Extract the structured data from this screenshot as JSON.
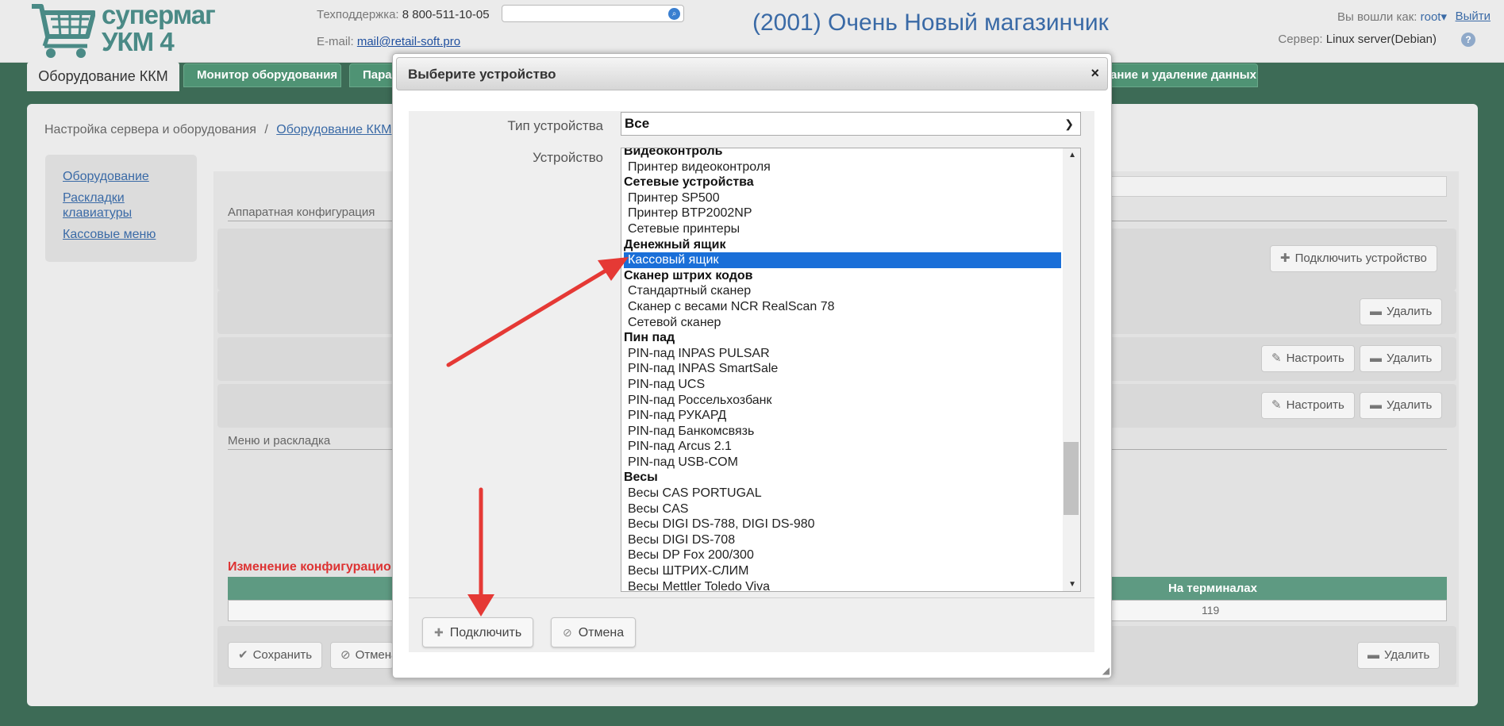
{
  "header": {
    "logo_line1": "супермаг",
    "logo_line2": "УКМ 4",
    "support_label": "Техподдержка:",
    "support_phone": "8 800-511-10-05",
    "email_label": "E-mail:",
    "email": "mail@retail-soft.pro",
    "shop_title": "(2001) Очень Новый магазинчик",
    "login_label": "Вы вошли как:",
    "login_user": "root",
    "logout": "Выйти",
    "server_label": "Сервер:",
    "server_value": "Linux server(Debian)",
    "help": "?"
  },
  "tabs": {
    "active": "Оборудование ККМ",
    "items": [
      "Монитор оборудования",
      "Парам",
      "ание и удаление данных"
    ]
  },
  "breadcrumb": {
    "root": "Настройка сервера и оборудования",
    "separator": "/",
    "current": "Оборудование ККМ"
  },
  "sidebar": {
    "items": [
      "Оборудование",
      "Раскладки клавиатуры",
      "Кассовые меню"
    ]
  },
  "content": {
    "hardware_section": "Аппаратная конфигурация",
    "menu_section": "Меню и раскладка",
    "connect_device": "Подключить устройство",
    "delete": "Удалить",
    "configure": "Настроить",
    "warning": "Изменение конфигурацио",
    "terminals_header": "На терминалах",
    "terminals_value": "119",
    "save": "Сохранить",
    "cancel": "Отмена"
  },
  "dialog": {
    "title": "Выберите устройство",
    "close": "×",
    "type_label": "Тип устройства",
    "type_value": "Все",
    "device_label": "Устройство",
    "devices": [
      {
        "text": "Видеоконтроль",
        "kind": "group"
      },
      {
        "text": "Принтер видеоконтроля",
        "kind": "item"
      },
      {
        "text": "Сетевые устройства",
        "kind": "group"
      },
      {
        "text": "Принтер SP500",
        "kind": "item"
      },
      {
        "text": "Принтер BTP2002NP",
        "kind": "item"
      },
      {
        "text": "Сетевые принтеры",
        "kind": "item"
      },
      {
        "text": "Денежный ящик",
        "kind": "group"
      },
      {
        "text": "Кассовый ящик",
        "kind": "selected"
      },
      {
        "text": "Сканер штрих кодов",
        "kind": "group"
      },
      {
        "text": "Стандартный сканер",
        "kind": "item"
      },
      {
        "text": "Сканер с весами NCR RealScan 78",
        "kind": "item"
      },
      {
        "text": "Сетевой сканер",
        "kind": "item"
      },
      {
        "text": "Пин пад",
        "kind": "group"
      },
      {
        "text": "PIN-пад INPAS PULSAR",
        "kind": "item"
      },
      {
        "text": "PIN-пад INPAS SmartSale",
        "kind": "item"
      },
      {
        "text": "PIN-пад UCS",
        "kind": "item"
      },
      {
        "text": "PIN-пад Россельхозбанк",
        "kind": "item"
      },
      {
        "text": "PIN-пад РУКАРД",
        "kind": "item"
      },
      {
        "text": "PIN-пад Банкомсвязь",
        "kind": "item"
      },
      {
        "text": "PIN-пад Arcus 2.1",
        "kind": "item"
      },
      {
        "text": "PIN-пад USB-COM",
        "kind": "item"
      },
      {
        "text": "Весы",
        "kind": "group"
      },
      {
        "text": "Весы CAS PORTUGAL",
        "kind": "item"
      },
      {
        "text": "Весы CAS",
        "kind": "item"
      },
      {
        "text": "Весы DIGI DS-788, DIGI DS-980",
        "kind": "item"
      },
      {
        "text": "Весы DIGI DS-708",
        "kind": "item"
      },
      {
        "text": "Весы DP Fox 200/300",
        "kind": "item"
      },
      {
        "text": "Весы ШТРИХ-СЛИМ",
        "kind": "item"
      },
      {
        "text": "Весы Mettler Toledo Viva",
        "kind": "item"
      }
    ],
    "connect": "Подключить",
    "cancel": "Отмена"
  },
  "colors": {
    "background": "#3d6b56",
    "tab_green": "#4f9374",
    "selected": "#1a6fd8",
    "annotation_arrow": "#e53935"
  }
}
